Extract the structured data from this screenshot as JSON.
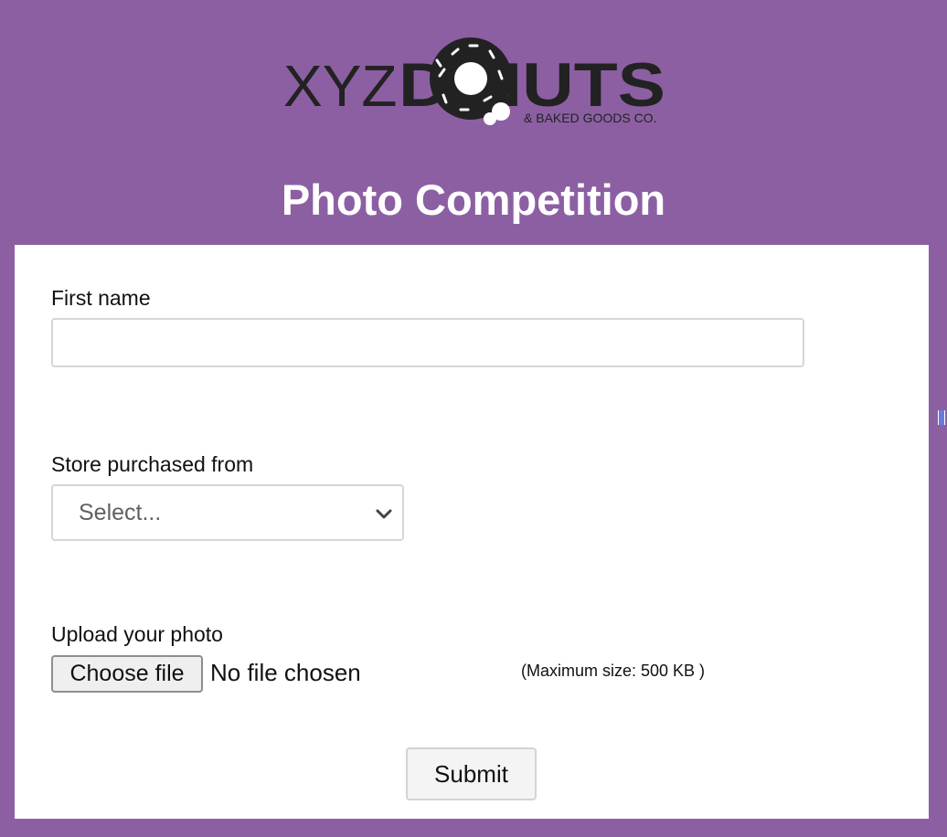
{
  "logo": {
    "brand_left": "XYZ",
    "brand_right": "D NUTS",
    "tagline": "& BAKED GOODS CO."
  },
  "page": {
    "title": "Photo Competition"
  },
  "form": {
    "first_name": {
      "label": "First name",
      "value": "",
      "placeholder": ""
    },
    "store": {
      "label": "Store purchased from",
      "selected": "Select..."
    },
    "upload": {
      "label": "Upload your photo",
      "button_label": "Choose file",
      "status": "No file chosen",
      "max_size": "(Maximum size: 500 KB )"
    },
    "submit_label": "Submit"
  },
  "icons": {
    "select_chevron": "chevron-down-icon",
    "logo_mark": "donut-icon"
  },
  "colors": {
    "background": "#8c5fa3",
    "card": "#ffffff",
    "logo_text": "#222222"
  }
}
